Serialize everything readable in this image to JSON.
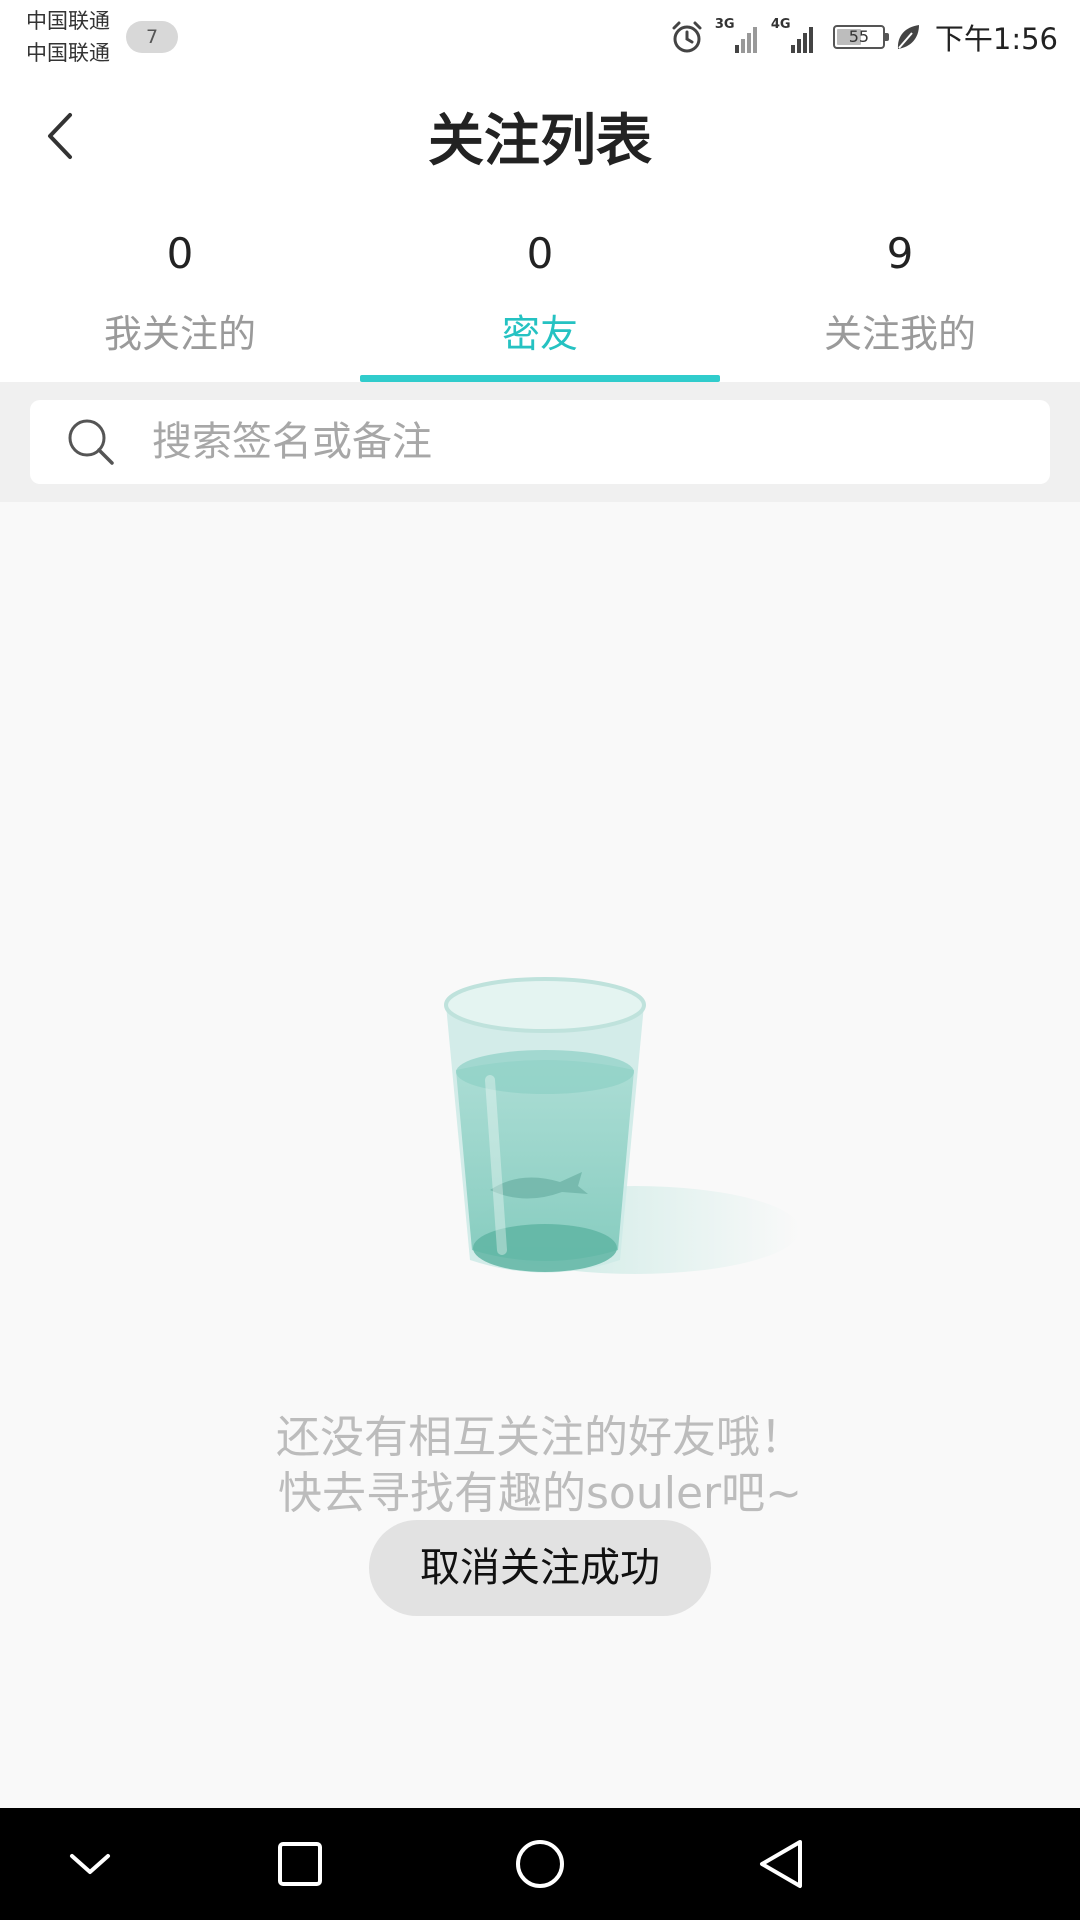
{
  "status_bar": {
    "carrier_1": "中国联通",
    "carrier_2": "中国联通",
    "notification_count": "7",
    "network_1": "3G",
    "network_2": "4G",
    "battery": "55",
    "battery_level": 0.55,
    "time": "下午1:56"
  },
  "header": {
    "title": "关注列表"
  },
  "tabs": [
    {
      "count": "0",
      "label": "我关注的",
      "active": false
    },
    {
      "count": "0",
      "label": "密友",
      "active": true
    },
    {
      "count": "9",
      "label": "关注我的",
      "active": false
    }
  ],
  "search": {
    "placeholder": "搜索签名或备注",
    "value": ""
  },
  "empty_state": {
    "line_1": "还没有相互关注的好友哦！",
    "line_2": "快去寻找有趣的souler吧~"
  },
  "toast": {
    "text": "取消关注成功"
  },
  "colors": {
    "accent": "#30cccc",
    "background": "#f9f9f9"
  }
}
